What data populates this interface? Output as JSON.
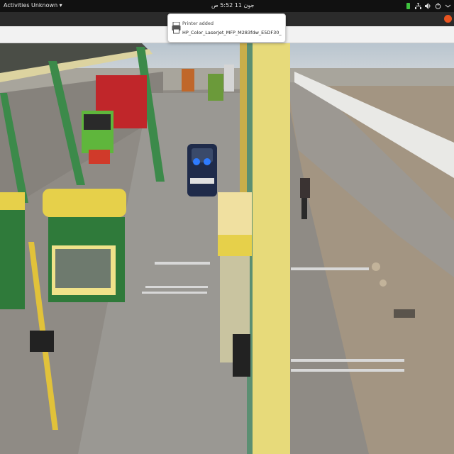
{
  "topbar": {
    "activities": "Activities",
    "app_menu": "Unknown ▾",
    "clock": "جون 11 5:52 ص",
    "tray_icons": [
      "green-status-icon",
      "network-icon",
      "volume-icon",
      "power-icon",
      "system-menu-icon"
    ]
  },
  "notification": {
    "title": "Printer added",
    "body": "HP_Color_LaserJet_MFP_M283fdw_E5DF30_",
    "icon": "printer-icon"
  },
  "colors": {
    "topbar_bg": "#111111",
    "notification_bg": "#ffffff",
    "accent": "#e95420",
    "booth_yellow": "#e6d04a",
    "booth_green": "#2f7a3a",
    "truck_red": "#c0262a",
    "police_light": "#2e7bff"
  }
}
